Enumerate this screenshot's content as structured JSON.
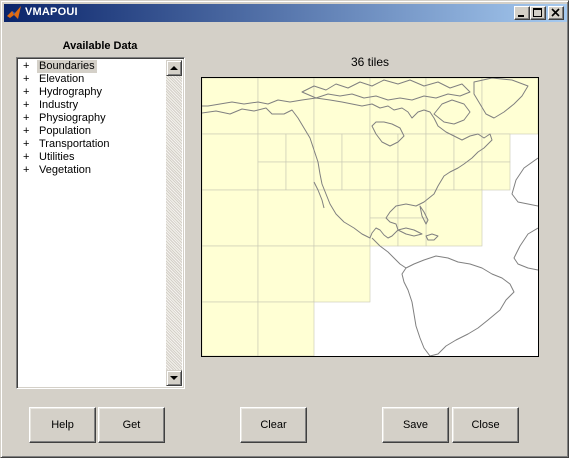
{
  "window": {
    "title": "VMAPOUI",
    "controls": [
      {
        "name": "minimize",
        "icon": "minimize-icon"
      },
      {
        "name": "maximize",
        "icon": "maximize-icon"
      },
      {
        "name": "close",
        "icon": "close-icon"
      }
    ]
  },
  "data_panel": {
    "heading": "Available Data",
    "items": [
      {
        "expander": "+",
        "label": "Boundaries",
        "selected": true
      },
      {
        "expander": "+",
        "label": "Elevation"
      },
      {
        "expander": "+",
        "label": "Hydrography"
      },
      {
        "expander": "+",
        "label": "Industry"
      },
      {
        "expander": "+",
        "label": "Physiography"
      },
      {
        "expander": "+",
        "label": "Population"
      },
      {
        "expander": "+",
        "label": "Transportation"
      },
      {
        "expander": "+",
        "label": "Utilities"
      },
      {
        "expander": "+",
        "label": "Vegetation"
      }
    ]
  },
  "map": {
    "tile_count_label": "36 tiles",
    "tile_fill_color": "#ffffd4",
    "tile_border_color": "#c8c8b4",
    "coastline_color": "#808080"
  },
  "buttons": {
    "help": "Help",
    "get": "Get",
    "clear": "Clear",
    "save": "Save",
    "close": "Close"
  },
  "colors": {
    "window_bg": "#d4d0c8",
    "titlebar_start": "#0a246a",
    "titlebar_end": "#a6caf0"
  }
}
